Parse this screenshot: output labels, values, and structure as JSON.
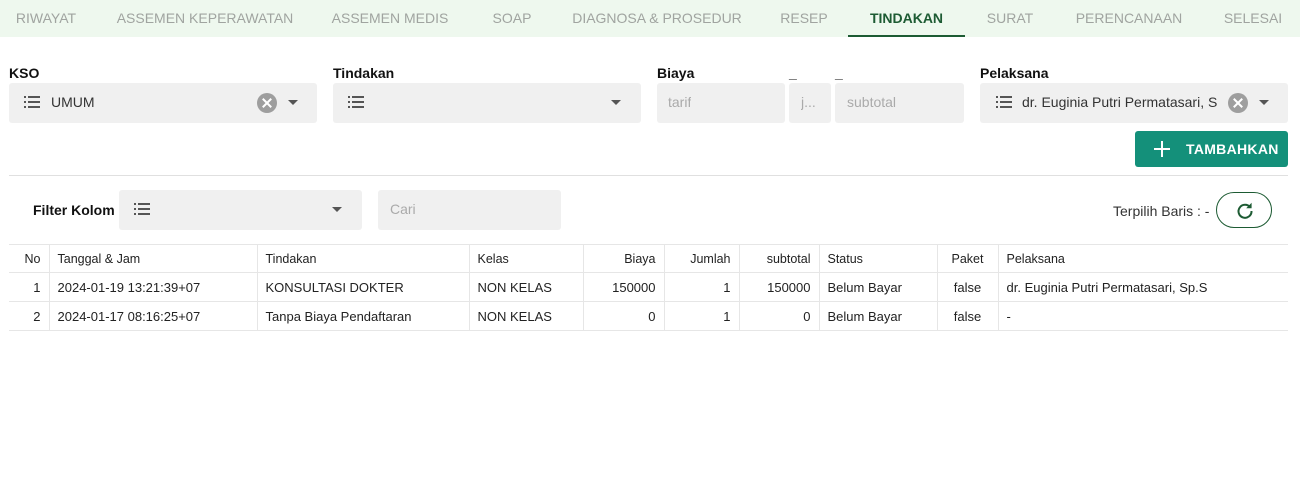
{
  "tabs": [
    {
      "label": "RIWAYAT"
    },
    {
      "label": "ASSEMEN KEPERAWATAN"
    },
    {
      "label": "ASSEMEN MEDIS"
    },
    {
      "label": "SOAP"
    },
    {
      "label": "DIAGNOSA & PROSEDUR"
    },
    {
      "label": "RESEP"
    },
    {
      "label": "TINDAKAN"
    },
    {
      "label": "SURAT"
    },
    {
      "label": "PERENCANAAN"
    },
    {
      "label": "SELESAI"
    }
  ],
  "active_tab": "TINDAKAN",
  "form": {
    "kso": {
      "label": "KSO",
      "value": "UMUM"
    },
    "tindakan": {
      "label": "Tindakan",
      "value": ""
    },
    "biaya": {
      "label": "Biaya",
      "tarif_placeholder": "tarif",
      "jumlah_label": "_",
      "jumlah_placeholder": "j...",
      "subtotal_label": "_",
      "subtotal_placeholder": "subtotal"
    },
    "pelaksana": {
      "label": "Pelaksana",
      "value": "dr. Euginia Putri Permatasari, S"
    },
    "add_button": "TAMBAHKAN"
  },
  "filter": {
    "label": "Filter Kolom",
    "search_placeholder": "Cari",
    "selected_rows_label": "Terpilih Baris : -"
  },
  "table": {
    "headers": [
      "No",
      "Tanggal & Jam",
      "Tindakan",
      "Kelas",
      "Biaya",
      "Jumlah",
      "subtotal",
      "Status",
      "Paket",
      "Pelaksana"
    ],
    "rows": [
      [
        "1",
        "2024-01-19 13:21:39+07",
        "KONSULTASI DOKTER",
        "NON KELAS",
        "150000",
        "1",
        "150000",
        "Belum Bayar",
        "false",
        "dr. Euginia Putri Permatasari, Sp.S"
      ],
      [
        "2",
        "2024-01-17 08:16:25+07",
        "Tanpa Biaya Pendaftaran",
        "NON KELAS",
        "0",
        "1",
        "0",
        "Belum Bayar",
        "false",
        "-"
      ]
    ]
  },
  "colors": {
    "tab_bar_bg": "#eef8ee",
    "active_tab": "#1d5b33",
    "add_button_bg": "#14907a"
  },
  "icons": [
    "list-icon",
    "clear-icon",
    "dropdown-arrow-icon",
    "plus-icon",
    "refresh-icon"
  ]
}
